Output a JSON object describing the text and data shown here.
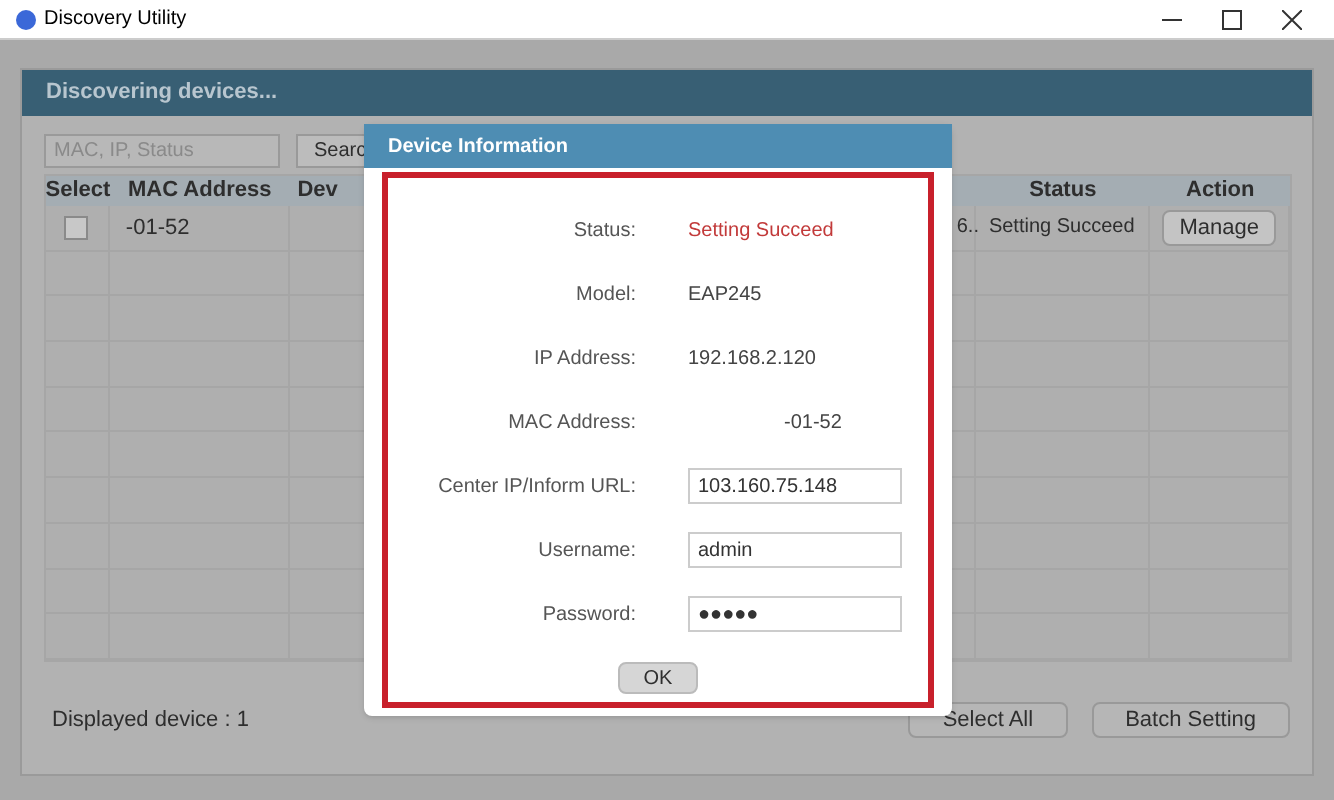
{
  "window": {
    "title": "Discovery Utility"
  },
  "panel": {
    "title": "Discovering devices..."
  },
  "search": {
    "placeholder": "MAC, IP, Status",
    "button": "Searc"
  },
  "table": {
    "columns": [
      "Select",
      "MAC Address",
      "Dev",
      "Status",
      "Action"
    ],
    "rows": [
      {
        "checked": false,
        "mac": "-01-52",
        "column_4": "6..",
        "status": "Setting Succeed",
        "action": "Manage"
      }
    ]
  },
  "footer": {
    "count": "Displayed device : 1",
    "buttons": [
      "Select All",
      "Batch Setting"
    ]
  },
  "dialog": {
    "title": "Device Information",
    "fields": [
      {
        "kind": "status",
        "label": "Status:",
        "value": "Setting Succeed"
      },
      {
        "kind": "text",
        "label": "Model:",
        "value": "EAP245"
      },
      {
        "kind": "text",
        "label": "IP Address:",
        "value": "192.168.2.120"
      },
      {
        "kind": "mac",
        "label": "MAC Address:",
        "value": "-01-52"
      },
      {
        "kind": "input",
        "label": "Center IP/Inform URL:",
        "value": "103.160.75.148"
      },
      {
        "kind": "input",
        "label": "Username:",
        "value": "admin"
      },
      {
        "kind": "input",
        "label": "Password:",
        "value": "●●●●●"
      }
    ],
    "ok": "OK"
  }
}
